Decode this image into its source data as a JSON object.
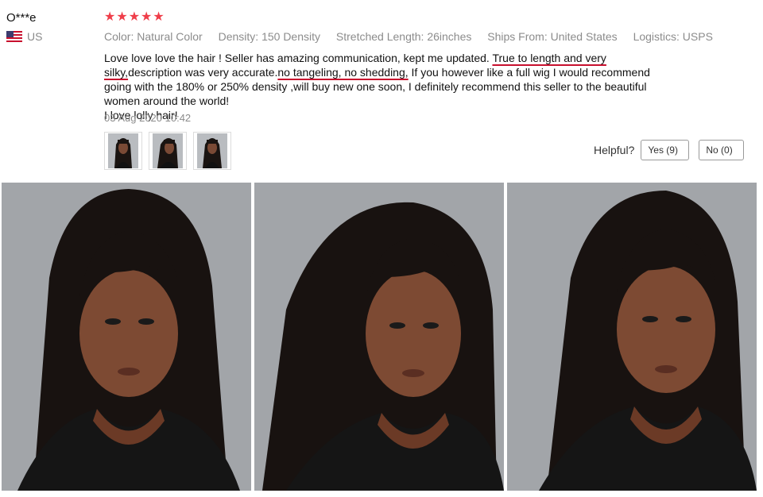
{
  "reviewer": {
    "name": "O***e",
    "country": "US",
    "flag_icon": "us-flag-icon"
  },
  "rating": {
    "stars": 5,
    "max": 5,
    "color": "#ef3e4a"
  },
  "attributes": [
    "Color: Natural Color",
    "Density: 150 Density",
    "Stretched Length: 26inches",
    "Ships From: United States",
    "Logistics: USPS"
  ],
  "review": {
    "part1": "Love love love the hair ! Seller has amazing communication, kept me updated. ",
    "highlight1": "True to length and very silky,",
    "part2": "description was very accurate.",
    "highlight2": "no tangeling, no shedding,",
    "part3": " If you however like a full wig I would recommend going with the 180% or 250% density ,will buy new one soon, I definitely recommend this seller to the beautiful women around the world!",
    "part4": "I love lolly hair!",
    "highlight_color": "#c8102e"
  },
  "date": "03 Aug 2020 10:42",
  "helpful": {
    "label": "Helpful?",
    "yes": "Yes (9)",
    "no": "No (0)"
  },
  "thumbnails": [
    "review-photo-1",
    "review-photo-2",
    "review-photo-3"
  ],
  "photos": [
    "review-photo-1",
    "review-photo-2",
    "review-photo-3"
  ]
}
